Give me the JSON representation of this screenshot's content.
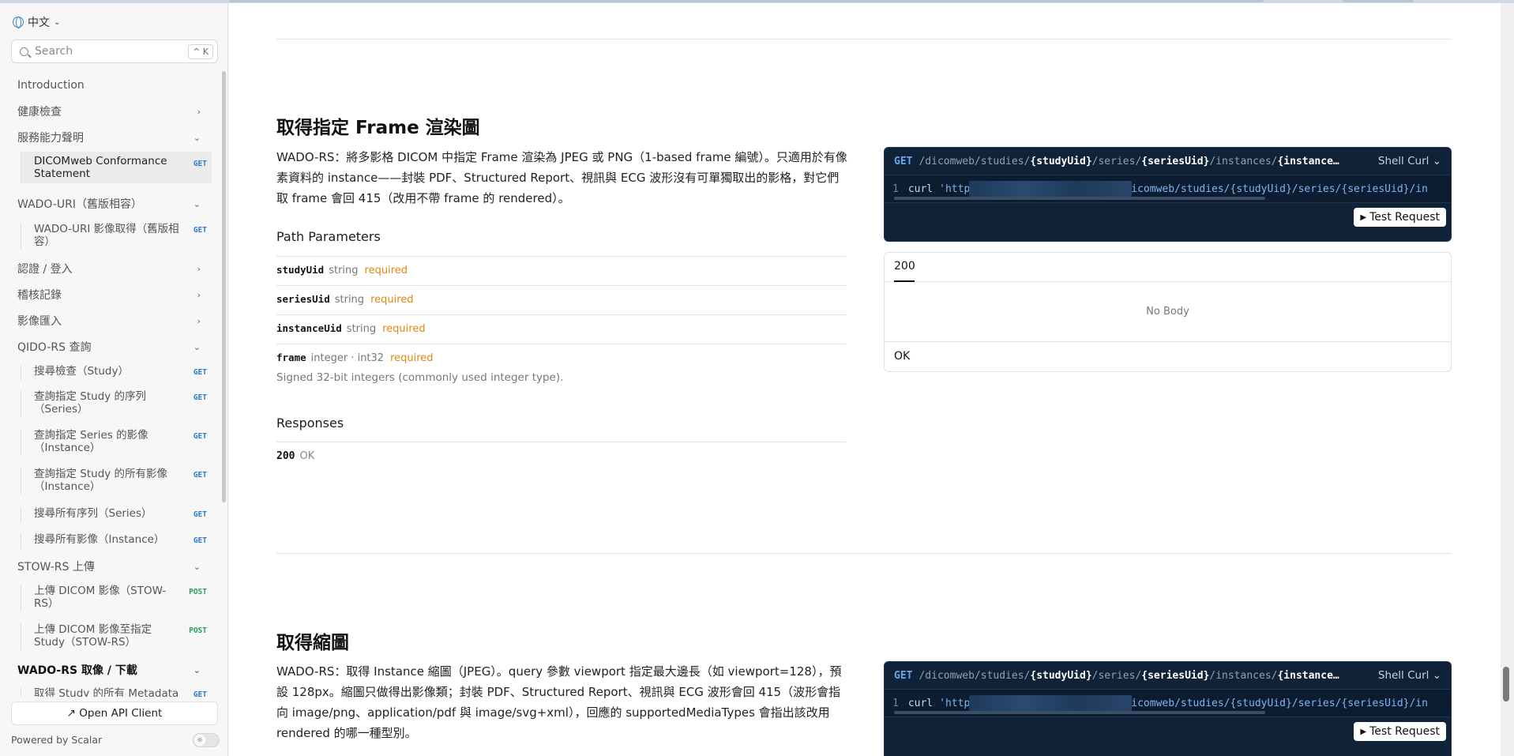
{
  "language": {
    "label": "中文"
  },
  "search": {
    "placeholder": "Search",
    "shortcut": "^ K"
  },
  "sidebar": {
    "items": [
      {
        "label": "Introduction"
      },
      {
        "label": "健康檢查"
      },
      {
        "label": "服務能力聲明"
      },
      {
        "label": "DICOMweb Conformance Statement",
        "method": "GET"
      },
      {
        "label": "WADO-URI（舊版相容）"
      },
      {
        "label": "WADO-URI 影像取得（舊版相容）",
        "method": "GET"
      },
      {
        "label": "認證 / 登入"
      },
      {
        "label": "稽核記錄"
      },
      {
        "label": "影像匯入"
      },
      {
        "label": "QIDO-RS 查詢"
      },
      {
        "label": "搜尋檢查（Study）",
        "method": "GET"
      },
      {
        "label": "查詢指定 Study 的序列（Series）",
        "method": "GET"
      },
      {
        "label": "查詢指定 Series 的影像（Instance）",
        "method": "GET"
      },
      {
        "label": "查詢指定 Study 的所有影像（Instance）",
        "method": "GET"
      },
      {
        "label": "搜尋所有序列（Series）",
        "method": "GET"
      },
      {
        "label": "搜尋所有影像（Instance）",
        "method": "GET"
      },
      {
        "label": "STOW-RS 上傳"
      },
      {
        "label": "上傳 DICOM 影像（STOW-RS）",
        "method": "POST"
      },
      {
        "label": "上傳 DICOM 影像至指定 Study（STOW-RS）",
        "method": "POST"
      },
      {
        "label": "WADO-RS 取像 / 下載"
      },
      {
        "label": "取得 Study 的所有 Metadata",
        "method": "GET"
      }
    ],
    "open_api_client": "↗ Open API Client",
    "powered_by": "Powered by Scalar"
  },
  "section1": {
    "title": "取得指定 Frame 渲染圖",
    "description": "WADO-RS：將多影格 DICOM 中指定 Frame 渲染為 JPEG 或 PNG（1-based frame 編號）。只適用於有像素資料的 instance——封裝 PDF、Structured Report、視訊與 ECG 波形沒有可單獨取出的影格，對它們取 frame 會回 415（改用不帶 frame 的 rendered）。",
    "path_params_heading": "Path Parameters",
    "params": [
      {
        "name": "studyUid",
        "type": "string",
        "required": "required"
      },
      {
        "name": "seriesUid",
        "type": "string",
        "required": "required"
      },
      {
        "name": "instanceUid",
        "type": "string",
        "required": "required"
      },
      {
        "name": "frame",
        "type": "integer · int32",
        "required": "required",
        "desc": "Signed 32-bit integers (commonly used integer type)."
      }
    ],
    "responses_heading": "Responses",
    "responses": [
      {
        "code": "200",
        "text": "OK"
      }
    ],
    "request": {
      "method": "GET",
      "path": {
        "p1": "/dicomweb/studies/",
        "v1": "{studyUid}",
        "p2": "/series/",
        "v2": "{seriesUid}",
        "p3": "/instances/",
        "v3": "{instance…"
      },
      "client": "Shell Curl",
      "line_no": "1",
      "curl": "curl",
      "url_start": "'http",
      "url_end": "icomweb/studies/{studyUid}/series/{seriesUid}/in",
      "test_button": "Test Request"
    },
    "response_box": {
      "tab": "200",
      "body": "No Body",
      "status": "OK"
    }
  },
  "section2": {
    "title": "取得縮圖",
    "description": "WADO-RS：取得 Instance 縮圖（JPEG）。query 參數 viewport 指定最大邊長（如 viewport=128），預設 128px。縮圖只做得出影像類；封裝 PDF、Structured Report、視訊與 ECG 波形會回 415（波形會指向 image/png、application/pdf 與 image/svg+xml），回應的 supportedMediaTypes 會指出該改用 rendered 的哪一種型別。",
    "request": {
      "method": "GET",
      "path": {
        "p1": "/dicomweb/studies/",
        "v1": "{studyUid}",
        "p2": "/series/",
        "v2": "{seriesUid}",
        "p3": "/instances/",
        "v3": "{instance…"
      },
      "client": "Shell Curl",
      "line_no": "1",
      "curl": "curl",
      "url_start": "'http",
      "url_end": "icomweb/studies/{studyUid}/series/{seriesUid}/in",
      "test_button": "Test Request"
    }
  }
}
